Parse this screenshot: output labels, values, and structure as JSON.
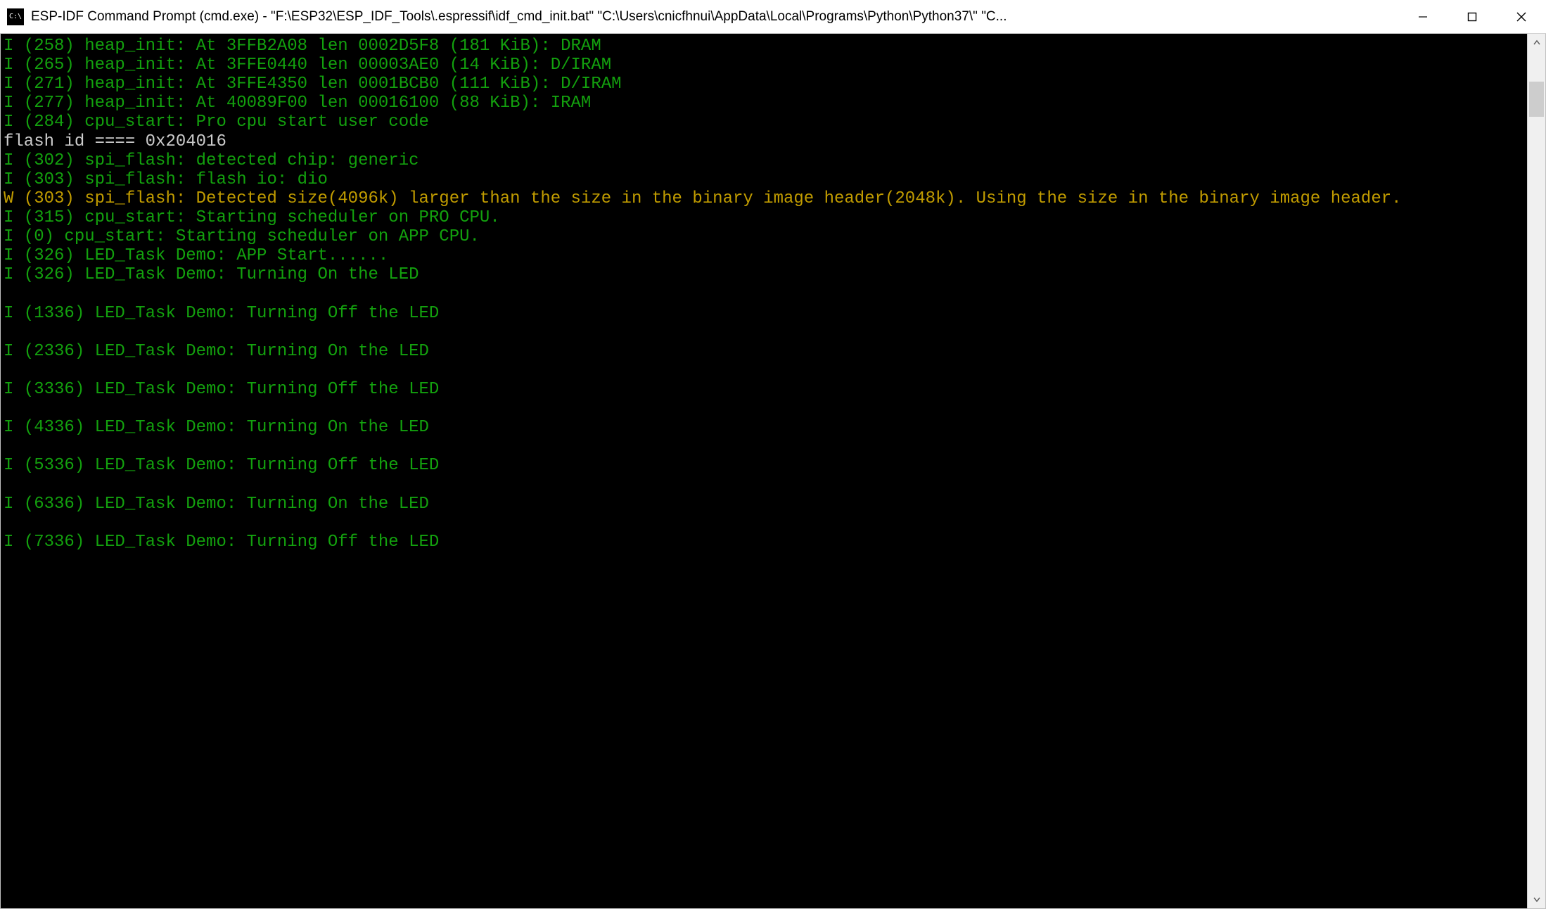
{
  "window": {
    "title": "ESP-IDF Command Prompt (cmd.exe) - \"F:\\ESP32\\ESP_IDF_Tools\\.espressif\\idf_cmd_init.bat\"  \"C:\\Users\\cnicfhnui\\AppData\\Local\\Programs\\Python\\Python37\\\" \"C...",
    "icon_label": "cmd-icon"
  },
  "colors": {
    "info": "#13a10e",
    "warn": "#c19c00",
    "plain": "#cccccc",
    "bg": "#000000"
  },
  "terminal": {
    "lines": [
      {
        "level": "info",
        "text": "I (258) heap_init: At 3FFB2A08 len 0002D5F8 (181 KiB): DRAM"
      },
      {
        "level": "info",
        "text": "I (265) heap_init: At 3FFE0440 len 00003AE0 (14 KiB): D/IRAM"
      },
      {
        "level": "info",
        "text": "I (271) heap_init: At 3FFE4350 len 0001BCB0 (111 KiB): D/IRAM"
      },
      {
        "level": "info",
        "text": "I (277) heap_init: At 40089F00 len 00016100 (88 KiB): IRAM"
      },
      {
        "level": "info",
        "text": "I (284) cpu_start: Pro cpu start user code"
      },
      {
        "level": "plain",
        "text": "flash id ==== 0x204016"
      },
      {
        "level": "info",
        "text": "I (302) spi_flash: detected chip: generic"
      },
      {
        "level": "info",
        "text": "I (303) spi_flash: flash io: dio"
      },
      {
        "level": "warn",
        "text": "W (303) spi_flash: Detected size(4096k) larger than the size in the binary image header(2048k). Using the size in the binary image header."
      },
      {
        "level": "info",
        "text": "I (315) cpu_start: Starting scheduler on PRO CPU."
      },
      {
        "level": "info",
        "text": "I (0) cpu_start: Starting scheduler on APP CPU."
      },
      {
        "level": "info",
        "text": "I (326) LED_Task Demo: APP Start......"
      },
      {
        "level": "info",
        "text": "I (326) LED_Task Demo: Turning On the LED"
      },
      {
        "level": "info",
        "text": ""
      },
      {
        "level": "info",
        "text": "I (1336) LED_Task Demo: Turning Off the LED"
      },
      {
        "level": "info",
        "text": ""
      },
      {
        "level": "info",
        "text": "I (2336) LED_Task Demo: Turning On the LED"
      },
      {
        "level": "info",
        "text": ""
      },
      {
        "level": "info",
        "text": "I (3336) LED_Task Demo: Turning Off the LED"
      },
      {
        "level": "info",
        "text": ""
      },
      {
        "level": "info",
        "text": "I (4336) LED_Task Demo: Turning On the LED"
      },
      {
        "level": "info",
        "text": ""
      },
      {
        "level": "info",
        "text": "I (5336) LED_Task Demo: Turning Off the LED"
      },
      {
        "level": "info",
        "text": ""
      },
      {
        "level": "info",
        "text": "I (6336) LED_Task Demo: Turning On the LED"
      },
      {
        "level": "info",
        "text": ""
      },
      {
        "level": "info",
        "text": "I (7336) LED_Task Demo: Turning Off the LED"
      },
      {
        "level": "info",
        "text": ""
      }
    ]
  }
}
